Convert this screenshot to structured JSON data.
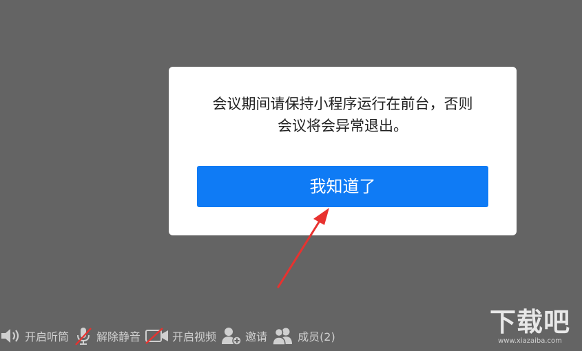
{
  "modal": {
    "message_line1": "会议期间请保持小程序运行在前台，否则",
    "message_line2": "会议将会异常退出。",
    "confirm_label": "我知道了"
  },
  "toolbar": {
    "items": [
      {
        "label": "开启听筒",
        "icon": "speaker-icon"
      },
      {
        "label": "解除静音",
        "icon": "microphone-muted-icon"
      },
      {
        "label": "开启视频",
        "icon": "video-off-icon"
      },
      {
        "label": "邀请",
        "icon": "invite-user-icon"
      },
      {
        "label": "成员(2)",
        "icon": "members-icon"
      }
    ]
  },
  "watermark": {
    "logo": "下载吧",
    "url": "www.xiazaiba.com"
  },
  "colors": {
    "backdrop": "#646464",
    "primary_button": "#0f7bf5",
    "annotation_arrow": "#e8322f"
  }
}
